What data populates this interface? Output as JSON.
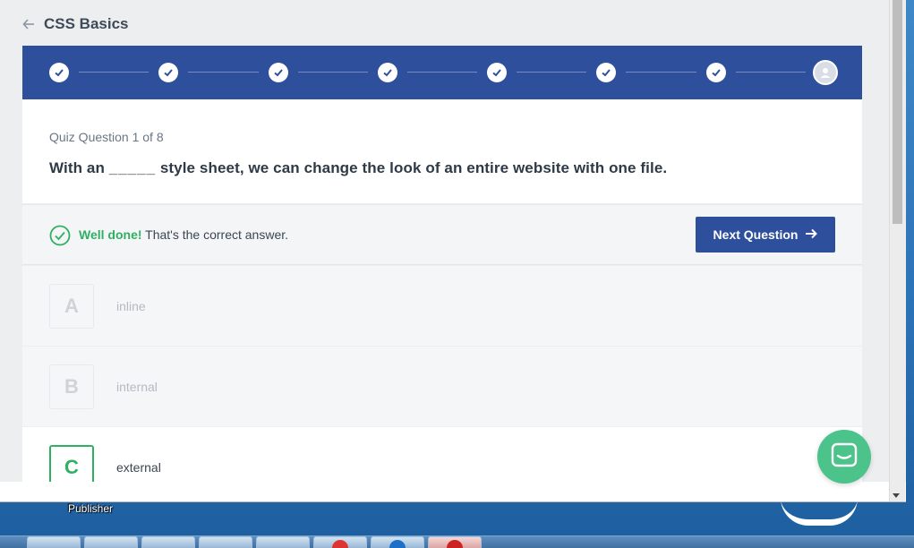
{
  "header": {
    "course_title": "CSS Basics"
  },
  "progress": {
    "total_steps": 8,
    "completed_steps": 7,
    "current_step": 8
  },
  "question": {
    "counter": "Quiz Question 1 of 8",
    "text_before": "With an ",
    "blank": "_____",
    "text_after": " style sheet, we can change the look of an entire website with one file."
  },
  "feedback": {
    "emphasis": "Well done!",
    "message": " That's the correct answer.",
    "next_label": "Next Question"
  },
  "options": [
    {
      "letter": "A",
      "label": "inline",
      "state": "incorrect"
    },
    {
      "letter": "B",
      "label": "internal",
      "state": "incorrect"
    },
    {
      "letter": "C",
      "label": "external",
      "state": "correct"
    }
  ],
  "desktop": {
    "icon_label": "Publisher"
  },
  "colors": {
    "primary": "#2d4f9c",
    "success": "#2fb063",
    "chat": "#4bc38a"
  }
}
